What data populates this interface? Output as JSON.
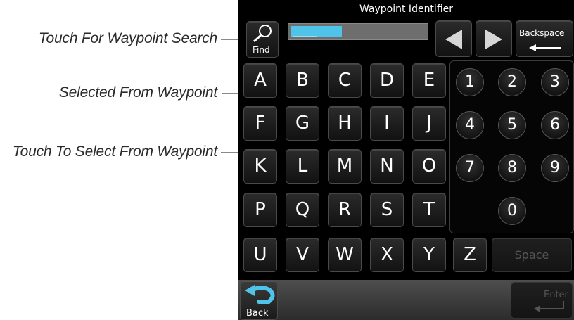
{
  "callouts": {
    "find": "Touch For Waypoint Search",
    "selected": "Selected From Waypoint",
    "select": "Touch To Select From Waypoint"
  },
  "screen": {
    "title": "Waypoint Identifier",
    "find_label": "Find",
    "backspace_label": "Backspace",
    "field_value": "______",
    "letters_row1": [
      "A",
      "B",
      "C",
      "D",
      "E"
    ],
    "letters_row2": [
      "F",
      "G",
      "H",
      "I",
      "J"
    ],
    "letters_row3": [
      "K",
      "L",
      "M",
      "N",
      "O"
    ],
    "letters_row4": [
      "P",
      "Q",
      "R",
      "S",
      "T"
    ],
    "letters_row5": [
      "U",
      "V",
      "W",
      "X",
      "Y",
      "Z"
    ],
    "numbers": [
      "1",
      "2",
      "3",
      "4",
      "5",
      "6",
      "7",
      "8",
      "9",
      "0"
    ],
    "space_label": "Space",
    "back_label": "Back",
    "enter_label": "Enter"
  },
  "colors": {
    "cursor": "#4fc3e8",
    "background": "#000000",
    "callout_line": "#8a8a8a"
  }
}
